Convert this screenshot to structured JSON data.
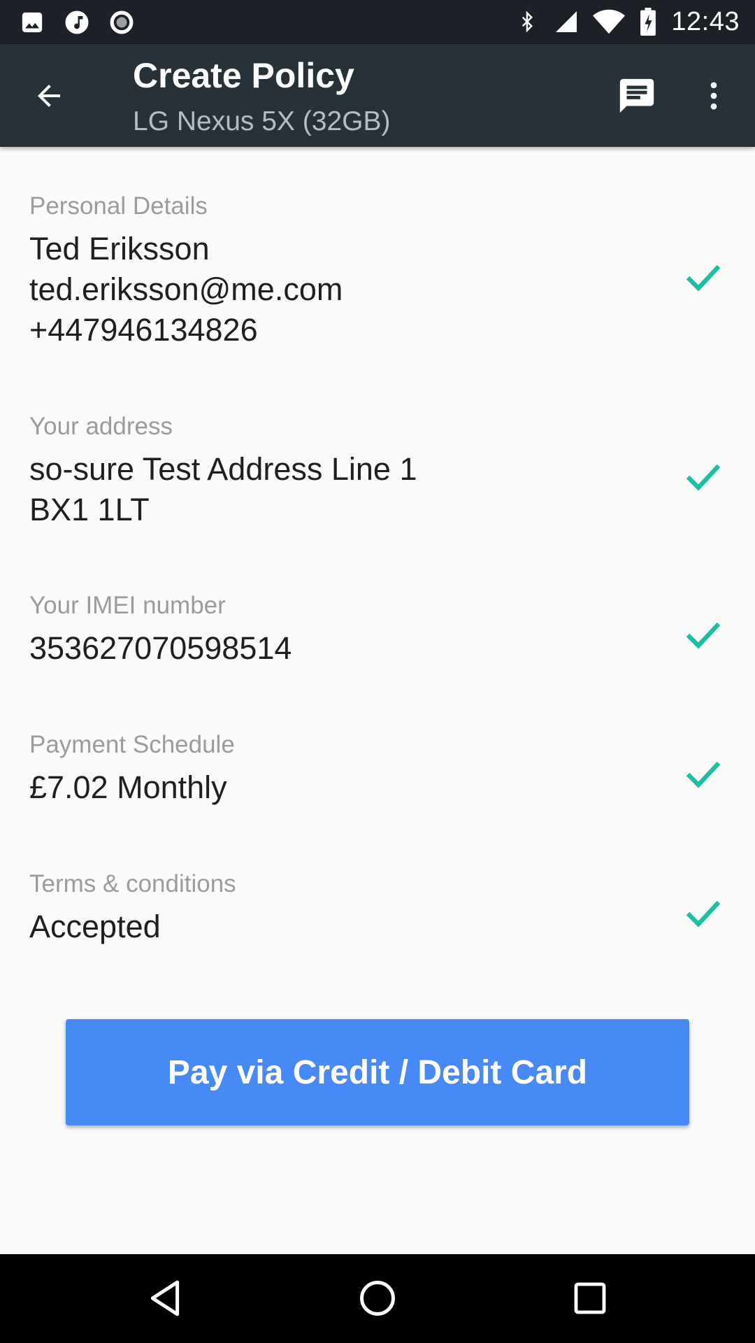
{
  "status_bar": {
    "time": "12:43",
    "left_icons": [
      "image-notification-icon",
      "music-notification-icon",
      "record-notification-icon"
    ],
    "right_icons": [
      "bluetooth-icon",
      "cell-signal-icon",
      "wifi-icon",
      "battery-charging-icon"
    ]
  },
  "app_bar": {
    "title": "Create Policy",
    "subtitle": "LG Nexus 5X (32GB)",
    "back_icon": "arrow-back-icon",
    "chat_icon": "chat-icon",
    "more_icon": "more-vert-icon",
    "background_color": "#263238"
  },
  "sections": [
    {
      "label": "Personal Details",
      "lines": [
        "Ted Eriksson",
        "ted.eriksson@me.com",
        "+447946134826"
      ],
      "checked": true
    },
    {
      "label": "Your address",
      "lines": [
        "so-sure Test Address Line 1",
        "BX1 1LT"
      ],
      "checked": true
    },
    {
      "label": "Your IMEI number",
      "lines": [
        "353627070598514"
      ],
      "checked": true
    },
    {
      "label": "Payment Schedule",
      "lines": [
        "£7.02 Monthly"
      ],
      "checked": true
    },
    {
      "label": "Terms & conditions",
      "lines": [
        "Accepted"
      ],
      "checked": true
    }
  ],
  "pay_button": {
    "label": "Pay via Credit / Debit Card",
    "color": "#4889f8"
  },
  "check_color": "#1cbfa2",
  "nav_bar": {
    "back_icon": "nav-back-icon",
    "home_icon": "nav-home-icon",
    "recents_icon": "nav-recents-icon"
  }
}
